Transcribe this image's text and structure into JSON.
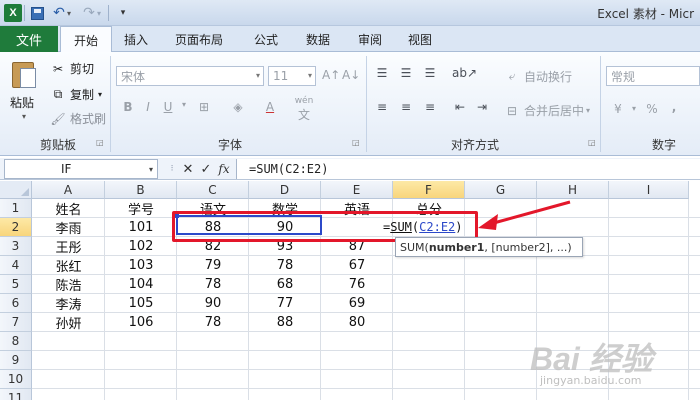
{
  "title_bar": {
    "app_icon": "X",
    "window_title": "Excel 素材 - Micr",
    "icons": [
      "excel-logo-icon",
      "save-icon",
      "undo-icon",
      "redo-icon",
      "customize-menu-icon"
    ]
  },
  "tabs": [
    {
      "label": "文件",
      "active": false
    },
    {
      "label": "开始",
      "active": true
    },
    {
      "label": "插入",
      "active": false
    },
    {
      "label": "页面布局",
      "active": false
    },
    {
      "label": "公式",
      "active": false
    },
    {
      "label": "数据",
      "active": false
    },
    {
      "label": "审阅",
      "active": false
    },
    {
      "label": "视图",
      "active": false
    }
  ],
  "ribbon": {
    "clipboard": {
      "paste_label": "粘贴",
      "cut_label": "剪切",
      "copy_label": "复制",
      "format_painter_label": "格式刷",
      "group_label": "剪贴板"
    },
    "font": {
      "font_name": "宋体",
      "font_size": "11",
      "bold": "B",
      "italic": "I",
      "underline": "U",
      "font_color": "A",
      "wen": "wén",
      "group_label": "字体"
    },
    "alignment": {
      "wrap_label": "自动换行",
      "merge_label": "合并后居中",
      "group_label": "对齐方式"
    },
    "number": {
      "format": "常规",
      "percent": "%",
      "comma": ",",
      "group_label": "数字"
    }
  },
  "formula_bar": {
    "name_box": "IF",
    "formula": "=SUM(C2:E2)",
    "fx": "fx"
  },
  "sheet": {
    "columns": [
      "A",
      "B",
      "C",
      "D",
      "E",
      "F",
      "G",
      "H",
      "I"
    ],
    "selected_column": "F",
    "rows": [
      "1",
      "2",
      "3",
      "4",
      "5",
      "6",
      "7",
      "8",
      "9",
      "10",
      "11"
    ],
    "selected_row": "2",
    "cells": [
      [
        "姓名",
        "学号",
        "语文",
        "数学",
        "英语",
        "总分"
      ],
      [
        "李雨",
        "101",
        "88",
        "90",
        "",
        ""
      ],
      [
        "王彤",
        "102",
        "82",
        "93",
        "87",
        ""
      ],
      [
        "张红",
        "103",
        "79",
        "78",
        "67",
        ""
      ],
      [
        "陈浩",
        "104",
        "78",
        "68",
        "76",
        ""
      ],
      [
        "李涛",
        "105",
        "90",
        "77",
        "69",
        ""
      ],
      [
        "孙妍",
        "106",
        "78",
        "88",
        "80",
        ""
      ]
    ],
    "edit_cell": {
      "eq": "=",
      "fn": "SUM",
      "open": "(",
      "ref": "C2:E2",
      "close": ")"
    },
    "tooltip": {
      "fn": "SUM(",
      "arg1": "number1",
      "rest": ", [number2], ...)"
    }
  },
  "watermark": {
    "text": "Bai 经验",
    "url": "jingyan.baidu.com"
  },
  "colors": {
    "file_tab": "#1f7b3b",
    "selection_blue": "#2c49c9",
    "annotation_red": "#e3172a",
    "header_selected": "#f8d57c"
  }
}
